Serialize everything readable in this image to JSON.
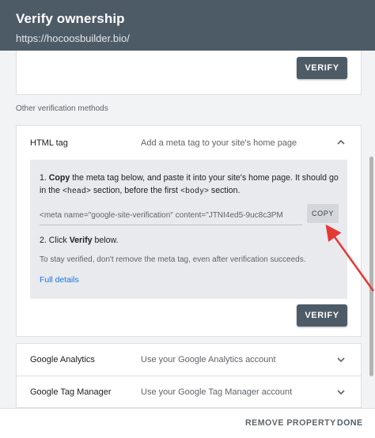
{
  "header": {
    "title": "Verify ownership",
    "url": "https://hocoosbuilder.bio/"
  },
  "top_card": {
    "verify_label": "VERIFY"
  },
  "other_methods_label": "Other verification methods",
  "html_tag": {
    "title": "HTML tag",
    "description": "Add a meta tag to your site's home page",
    "step1": {
      "num": "1. ",
      "bold": "Copy",
      "text_a": " the meta tag below, and paste it into your site's home page. It should go in the ",
      "code_head": "<head>",
      "text_b": " section, before the first ",
      "code_body": "<body>",
      "text_c": " section."
    },
    "meta_value": "<meta name=\"google-site-verification\" content=\"JTNI4ed5-9uc8c3PM",
    "copy_label": "COPY",
    "step2": {
      "num": "2. Click ",
      "bold": "Verify",
      "text": " below."
    },
    "note": "To stay verified, don't remove the meta tag, even after verification succeeds.",
    "full_details": "Full details",
    "verify_label": "VERIFY"
  },
  "google_analytics": {
    "title": "Google Analytics",
    "description": "Use your Google Analytics account"
  },
  "google_tag_manager": {
    "title": "Google Tag Manager",
    "description": "Use your Google Tag Manager account"
  },
  "footer": {
    "remove_label": "REMOVE PROPERTY",
    "done_label": "DONE"
  },
  "colors": {
    "header_bg": "#4d5b66",
    "link": "#1a73e8",
    "annotation_arrow": "#e53935"
  },
  "icons": [
    "chevron-up-icon",
    "chevron-down-icon",
    "annotation-arrow"
  ]
}
